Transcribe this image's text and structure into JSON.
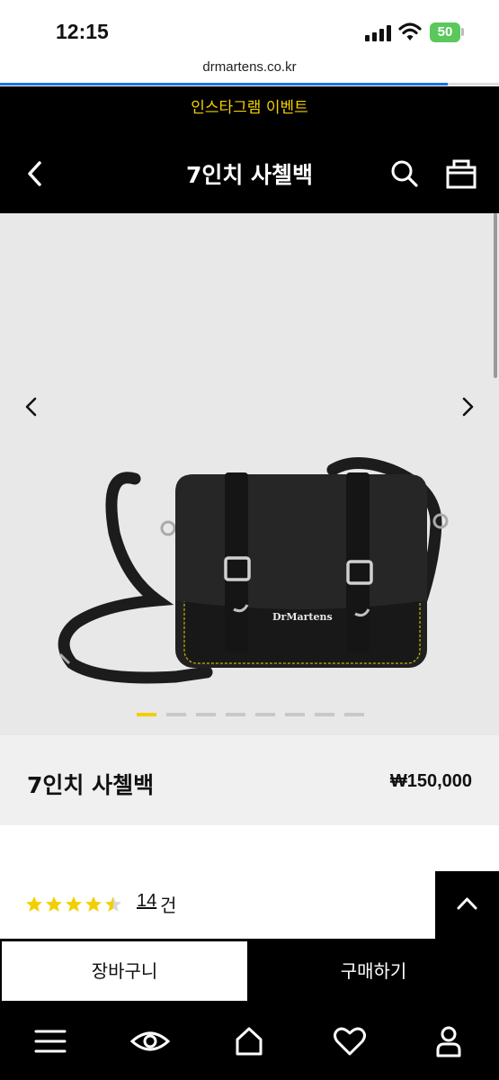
{
  "status_bar": {
    "time": "12:15",
    "battery": "50"
  },
  "browser": {
    "url": "drmartens.co.kr"
  },
  "promo_banner": {
    "text": "인스타그램 이벤트"
  },
  "header": {
    "title": "7인치 사첼백",
    "back_icon": "chevron-left-icon",
    "search_icon": "search-icon",
    "bag_icon": "shopping-bag-icon"
  },
  "gallery": {
    "slide_count": 8,
    "active_slide": 1,
    "brand_label": "DrMartens"
  },
  "product": {
    "name": "7인치 사첼백",
    "price": "₩150,000"
  },
  "reviews": {
    "rating": 4.5,
    "count": "14",
    "unit": "건"
  },
  "actions": {
    "cart_label": "장바구니",
    "buy_label": "구매하기"
  },
  "tab_bar": {
    "items": [
      "menu-icon",
      "eye-icon",
      "home-icon",
      "heart-icon",
      "user-icon"
    ]
  },
  "colors": {
    "accent": "#f2cf00",
    "header_bg": "#000000",
    "gallery_bg": "#e8e8e8",
    "info_bg": "#f0f0f0"
  }
}
